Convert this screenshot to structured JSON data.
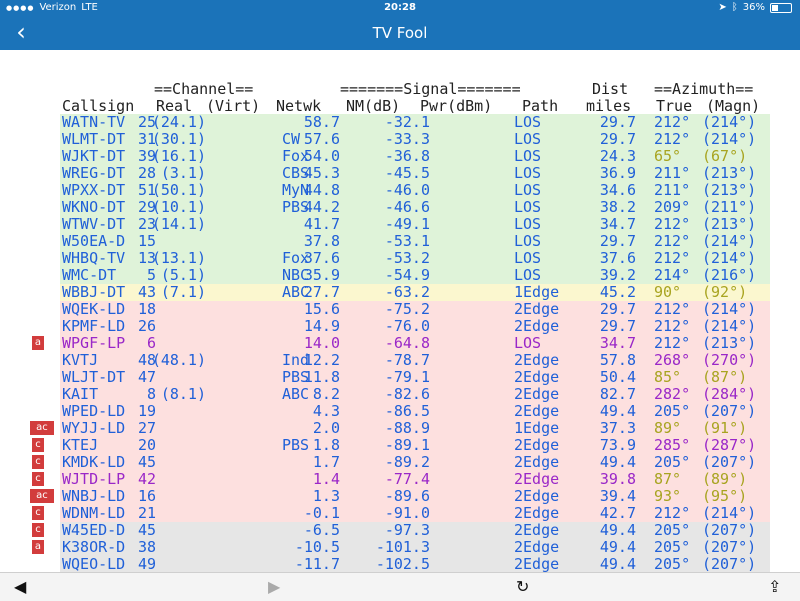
{
  "status_bar": {
    "carrier": "Verizon",
    "network": "LTE",
    "time": "20:28",
    "battery": "36%"
  },
  "nav": {
    "title": "TV Fool",
    "back_icon": "chevron-left-icon"
  },
  "headers": {
    "group_channel": "==Channel==",
    "group_signal": "=======Signal=======",
    "dist_top": "Dist",
    "group_azimuth": "==Azimuth==",
    "callsign": "Callsign",
    "real": "Real",
    "virt": "(Virt)",
    "netwk": "Netwk",
    "nm": "NM(dB)",
    "pwr": "Pwr(dBm)",
    "path": "Path",
    "miles": "miles",
    "true": "True",
    "magn": "(Magn)"
  },
  "rows": [
    {
      "callsign": "WATN-TV",
      "real": "25",
      "virt": "(24.1)",
      "netwk": "",
      "nm": "58.7",
      "pwr": "-32.1",
      "path": "LOS",
      "dist": "29.7",
      "az_true": "212°",
      "az_magn": "(214°)",
      "bg": "#dff3d9",
      "text": "#2060d8",
      "azc": "#2060d8"
    },
    {
      "callsign": "WLMT-DT",
      "real": "31",
      "virt": "(30.1)",
      "netwk": "CW",
      "nm": "57.6",
      "pwr": "-33.3",
      "path": "LOS",
      "dist": "29.7",
      "az_true": "212°",
      "az_magn": "(214°)",
      "bg": "#dff3d9",
      "text": "#2060d8",
      "azc": "#2060d8"
    },
    {
      "callsign": "WJKT-DT",
      "real": "39",
      "virt": "(16.1)",
      "netwk": "Fox",
      "nm": "54.0",
      "pwr": "-36.8",
      "path": "LOS",
      "dist": "24.3",
      "az_true": "65°",
      "az_magn": "(67°)",
      "bg": "#dff3d9",
      "text": "#2060d8",
      "azc": "#a8a420"
    },
    {
      "callsign": "WREG-DT",
      "real": "28",
      "virt": "(3.1)",
      "netwk": "CBS",
      "nm": "45.3",
      "pwr": "-45.5",
      "path": "LOS",
      "dist": "36.9",
      "az_true": "211°",
      "az_magn": "(213°)",
      "bg": "#dff3d9",
      "text": "#2060d8",
      "azc": "#2060d8"
    },
    {
      "callsign": "WPXX-DT",
      "real": "51",
      "virt": "(50.1)",
      "netwk": "MyN",
      "nm": "44.8",
      "pwr": "-46.0",
      "path": "LOS",
      "dist": "34.6",
      "az_true": "211°",
      "az_magn": "(213°)",
      "bg": "#dff3d9",
      "text": "#2060d8",
      "azc": "#2060d8"
    },
    {
      "callsign": "WKNO-DT",
      "real": "29",
      "virt": "(10.1)",
      "netwk": "PBS",
      "nm": "44.2",
      "pwr": "-46.6",
      "path": "LOS",
      "dist": "38.2",
      "az_true": "209°",
      "az_magn": "(211°)",
      "bg": "#dff3d9",
      "text": "#2060d8",
      "azc": "#2060d8"
    },
    {
      "callsign": "WTWV-DT",
      "real": "23",
      "virt": "(14.1)",
      "netwk": "",
      "nm": "41.7",
      "pwr": "-49.1",
      "path": "LOS",
      "dist": "34.7",
      "az_true": "212°",
      "az_magn": "(213°)",
      "bg": "#dff3d9",
      "text": "#2060d8",
      "azc": "#2060d8"
    },
    {
      "callsign": "W50EA-D",
      "real": "15",
      "virt": "",
      "netwk": "",
      "nm": "37.8",
      "pwr": "-53.1",
      "path": "LOS",
      "dist": "29.7",
      "az_true": "212°",
      "az_magn": "(214°)",
      "bg": "#dff3d9",
      "text": "#2060d8",
      "azc": "#2060d8"
    },
    {
      "callsign": "WHBQ-TV",
      "real": "13",
      "virt": "(13.1)",
      "netwk": "Fox",
      "nm": "37.6",
      "pwr": "-53.2",
      "path": "LOS",
      "dist": "37.6",
      "az_true": "212°",
      "az_magn": "(214°)",
      "bg": "#dff3d9",
      "text": "#2060d8",
      "azc": "#2060d8"
    },
    {
      "callsign": "WMC-DT",
      "real": "5",
      "virt": "(5.1)",
      "netwk": "NBC",
      "nm": "35.9",
      "pwr": "-54.9",
      "path": "LOS",
      "dist": "39.2",
      "az_true": "214°",
      "az_magn": "(216°)",
      "bg": "#dff3d9",
      "text": "#2060d8",
      "azc": "#2060d8"
    },
    {
      "callsign": "WBBJ-DT",
      "real": "43",
      "virt": "(7.1)",
      "netwk": "ABC",
      "nm": "27.7",
      "pwr": "-63.2",
      "path": "1Edge",
      "dist": "45.2",
      "az_true": "90°",
      "az_magn": "(92°)",
      "bg": "#fbf7cf",
      "text": "#2060d8",
      "azc": "#a8a420"
    },
    {
      "callsign": "WQEK-LD",
      "real": "18",
      "virt": "",
      "netwk": "",
      "nm": "15.6",
      "pwr": "-75.2",
      "path": "2Edge",
      "dist": "29.7",
      "az_true": "212°",
      "az_magn": "(214°)",
      "bg": "#fde0df",
      "text": "#2060d8",
      "azc": "#2060d8"
    },
    {
      "callsign": "KPMF-LD",
      "real": "26",
      "virt": "",
      "netwk": "",
      "nm": "14.9",
      "pwr": "-76.0",
      "path": "2Edge",
      "dist": "29.7",
      "az_true": "212°",
      "az_magn": "(214°)",
      "bg": "#fde0df",
      "text": "#2060d8",
      "azc": "#2060d8"
    },
    {
      "callsign": "WPGF-LP",
      "real": "6",
      "virt": "",
      "netwk": "",
      "nm": "14.0",
      "pwr": "-64.8",
      "path": "LOS",
      "dist": "34.7",
      "az_true": "212°",
      "az_magn": "(213°)",
      "bg": "#fde0df",
      "text": "#9a27c8",
      "azc": "#2060d8"
    },
    {
      "callsign": "KVTJ",
      "real": "48",
      "virt": "(48.1)",
      "netwk": "Ind",
      "nm": "12.2",
      "pwr": "-78.7",
      "path": "2Edge",
      "dist": "57.8",
      "az_true": "268°",
      "az_magn": "(270°)",
      "bg": "#fde0df",
      "text": "#2060d8",
      "azc": "#9a27c8"
    },
    {
      "callsign": "WLJT-DT",
      "real": "47",
      "virt": "",
      "netwk": "PBS",
      "nm": "11.8",
      "pwr": "-79.1",
      "path": "2Edge",
      "dist": "50.4",
      "az_true": "85°",
      "az_magn": "(87°)",
      "bg": "#fde0df",
      "text": "#2060d8",
      "azc": "#a8a420"
    },
    {
      "callsign": "KAIT",
      "real": "8",
      "virt": "(8.1)",
      "netwk": "ABC",
      "nm": "8.2",
      "pwr": "-82.6",
      "path": "2Edge",
      "dist": "82.7",
      "az_true": "282°",
      "az_magn": "(284°)",
      "bg": "#fde0df",
      "text": "#2060d8",
      "azc": "#9a27c8"
    },
    {
      "callsign": "WPED-LD",
      "real": "19",
      "virt": "",
      "netwk": "",
      "nm": "4.3",
      "pwr": "-86.5",
      "path": "2Edge",
      "dist": "49.4",
      "az_true": "205°",
      "az_magn": "(207°)",
      "bg": "#fde0df",
      "text": "#2060d8",
      "azc": "#2060d8"
    },
    {
      "callsign": "WYJJ-LD",
      "real": "27",
      "virt": "",
      "netwk": "",
      "nm": "2.0",
      "pwr": "-88.9",
      "path": "1Edge",
      "dist": "37.3",
      "az_true": "89°",
      "az_magn": "(91°)",
      "bg": "#fde0df",
      "text": "#2060d8",
      "azc": "#a8a420"
    },
    {
      "callsign": "KTEJ",
      "real": "20",
      "virt": "",
      "netwk": "PBS",
      "nm": "1.8",
      "pwr": "-89.1",
      "path": "2Edge",
      "dist": "73.9",
      "az_true": "285°",
      "az_magn": "(287°)",
      "bg": "#fde0df",
      "text": "#2060d8",
      "azc": "#9a27c8"
    },
    {
      "callsign": "KMDK-LD",
      "real": "45",
      "virt": "",
      "netwk": "",
      "nm": "1.7",
      "pwr": "-89.2",
      "path": "2Edge",
      "dist": "49.4",
      "az_true": "205°",
      "az_magn": "(207°)",
      "bg": "#fde0df",
      "text": "#2060d8",
      "azc": "#2060d8"
    },
    {
      "callsign": "WJTD-LP",
      "real": "42",
      "virt": "",
      "netwk": "",
      "nm": "1.4",
      "pwr": "-77.4",
      "path": "2Edge",
      "dist": "39.8",
      "az_true": "87°",
      "az_magn": "(89°)",
      "bg": "#fde0df",
      "text": "#9a27c8",
      "azc": "#a8a420"
    },
    {
      "callsign": "WNBJ-LD",
      "real": "16",
      "virt": "",
      "netwk": "",
      "nm": "1.3",
      "pwr": "-89.6",
      "path": "2Edge",
      "dist": "39.4",
      "az_true": "93°",
      "az_magn": "(95°)",
      "bg": "#fde0df",
      "text": "#2060d8",
      "azc": "#a8a420"
    },
    {
      "callsign": "WDNM-LD",
      "real": "21",
      "virt": "",
      "netwk": "",
      "nm": "-0.1",
      "pwr": "-91.0",
      "path": "2Edge",
      "dist": "42.7",
      "az_true": "212°",
      "az_magn": "(214°)",
      "bg": "#fde0df",
      "text": "#2060d8",
      "azc": "#2060d8"
    },
    {
      "callsign": "W45ED-D",
      "real": "45",
      "virt": "",
      "netwk": "",
      "nm": "-6.5",
      "pwr": "-97.3",
      "path": "2Edge",
      "dist": "49.4",
      "az_true": "205°",
      "az_magn": "(207°)",
      "bg": "#e6e6e6",
      "text": "#2060d8",
      "azc": "#2060d8"
    },
    {
      "callsign": "K38OR-D",
      "real": "38",
      "virt": "",
      "netwk": "",
      "nm": "-10.5",
      "pwr": "-101.3",
      "path": "2Edge",
      "dist": "49.4",
      "az_true": "205°",
      "az_magn": "(207°)",
      "bg": "#e6e6e6",
      "text": "#2060d8",
      "azc": "#2060d8"
    },
    {
      "callsign": "WQEO-LD",
      "real": "49",
      "virt": "",
      "netwk": "",
      "nm": "-11.7",
      "pwr": "-102.5",
      "path": "2Edge",
      "dist": "49.4",
      "az_true": "205°",
      "az_magn": "(207°)",
      "bg": "#e6e6e6",
      "text": "#2060d8",
      "azc": "#2060d8"
    }
  ],
  "badges": [
    {
      "label": "a",
      "row": 13,
      "wide": false
    },
    {
      "label": "ac",
      "row": 18,
      "wide": true
    },
    {
      "label": "c",
      "row": 19,
      "wide": false
    },
    {
      "label": "c",
      "row": 20,
      "wide": false
    },
    {
      "label": "c",
      "row": 21,
      "wide": false
    },
    {
      "label": "ac",
      "row": 22,
      "wide": true
    },
    {
      "label": "c",
      "row": 23,
      "wide": false
    },
    {
      "label": "c",
      "row": 24,
      "wide": false
    },
    {
      "label": "a",
      "row": 25,
      "wide": false
    }
  ],
  "toolbar": {
    "back": "◀",
    "forward": "▶",
    "reload": "↻",
    "share": "⇪"
  },
  "colors": {
    "bar_blue": "#1b73b9",
    "badge_red": "#d23c3c"
  }
}
